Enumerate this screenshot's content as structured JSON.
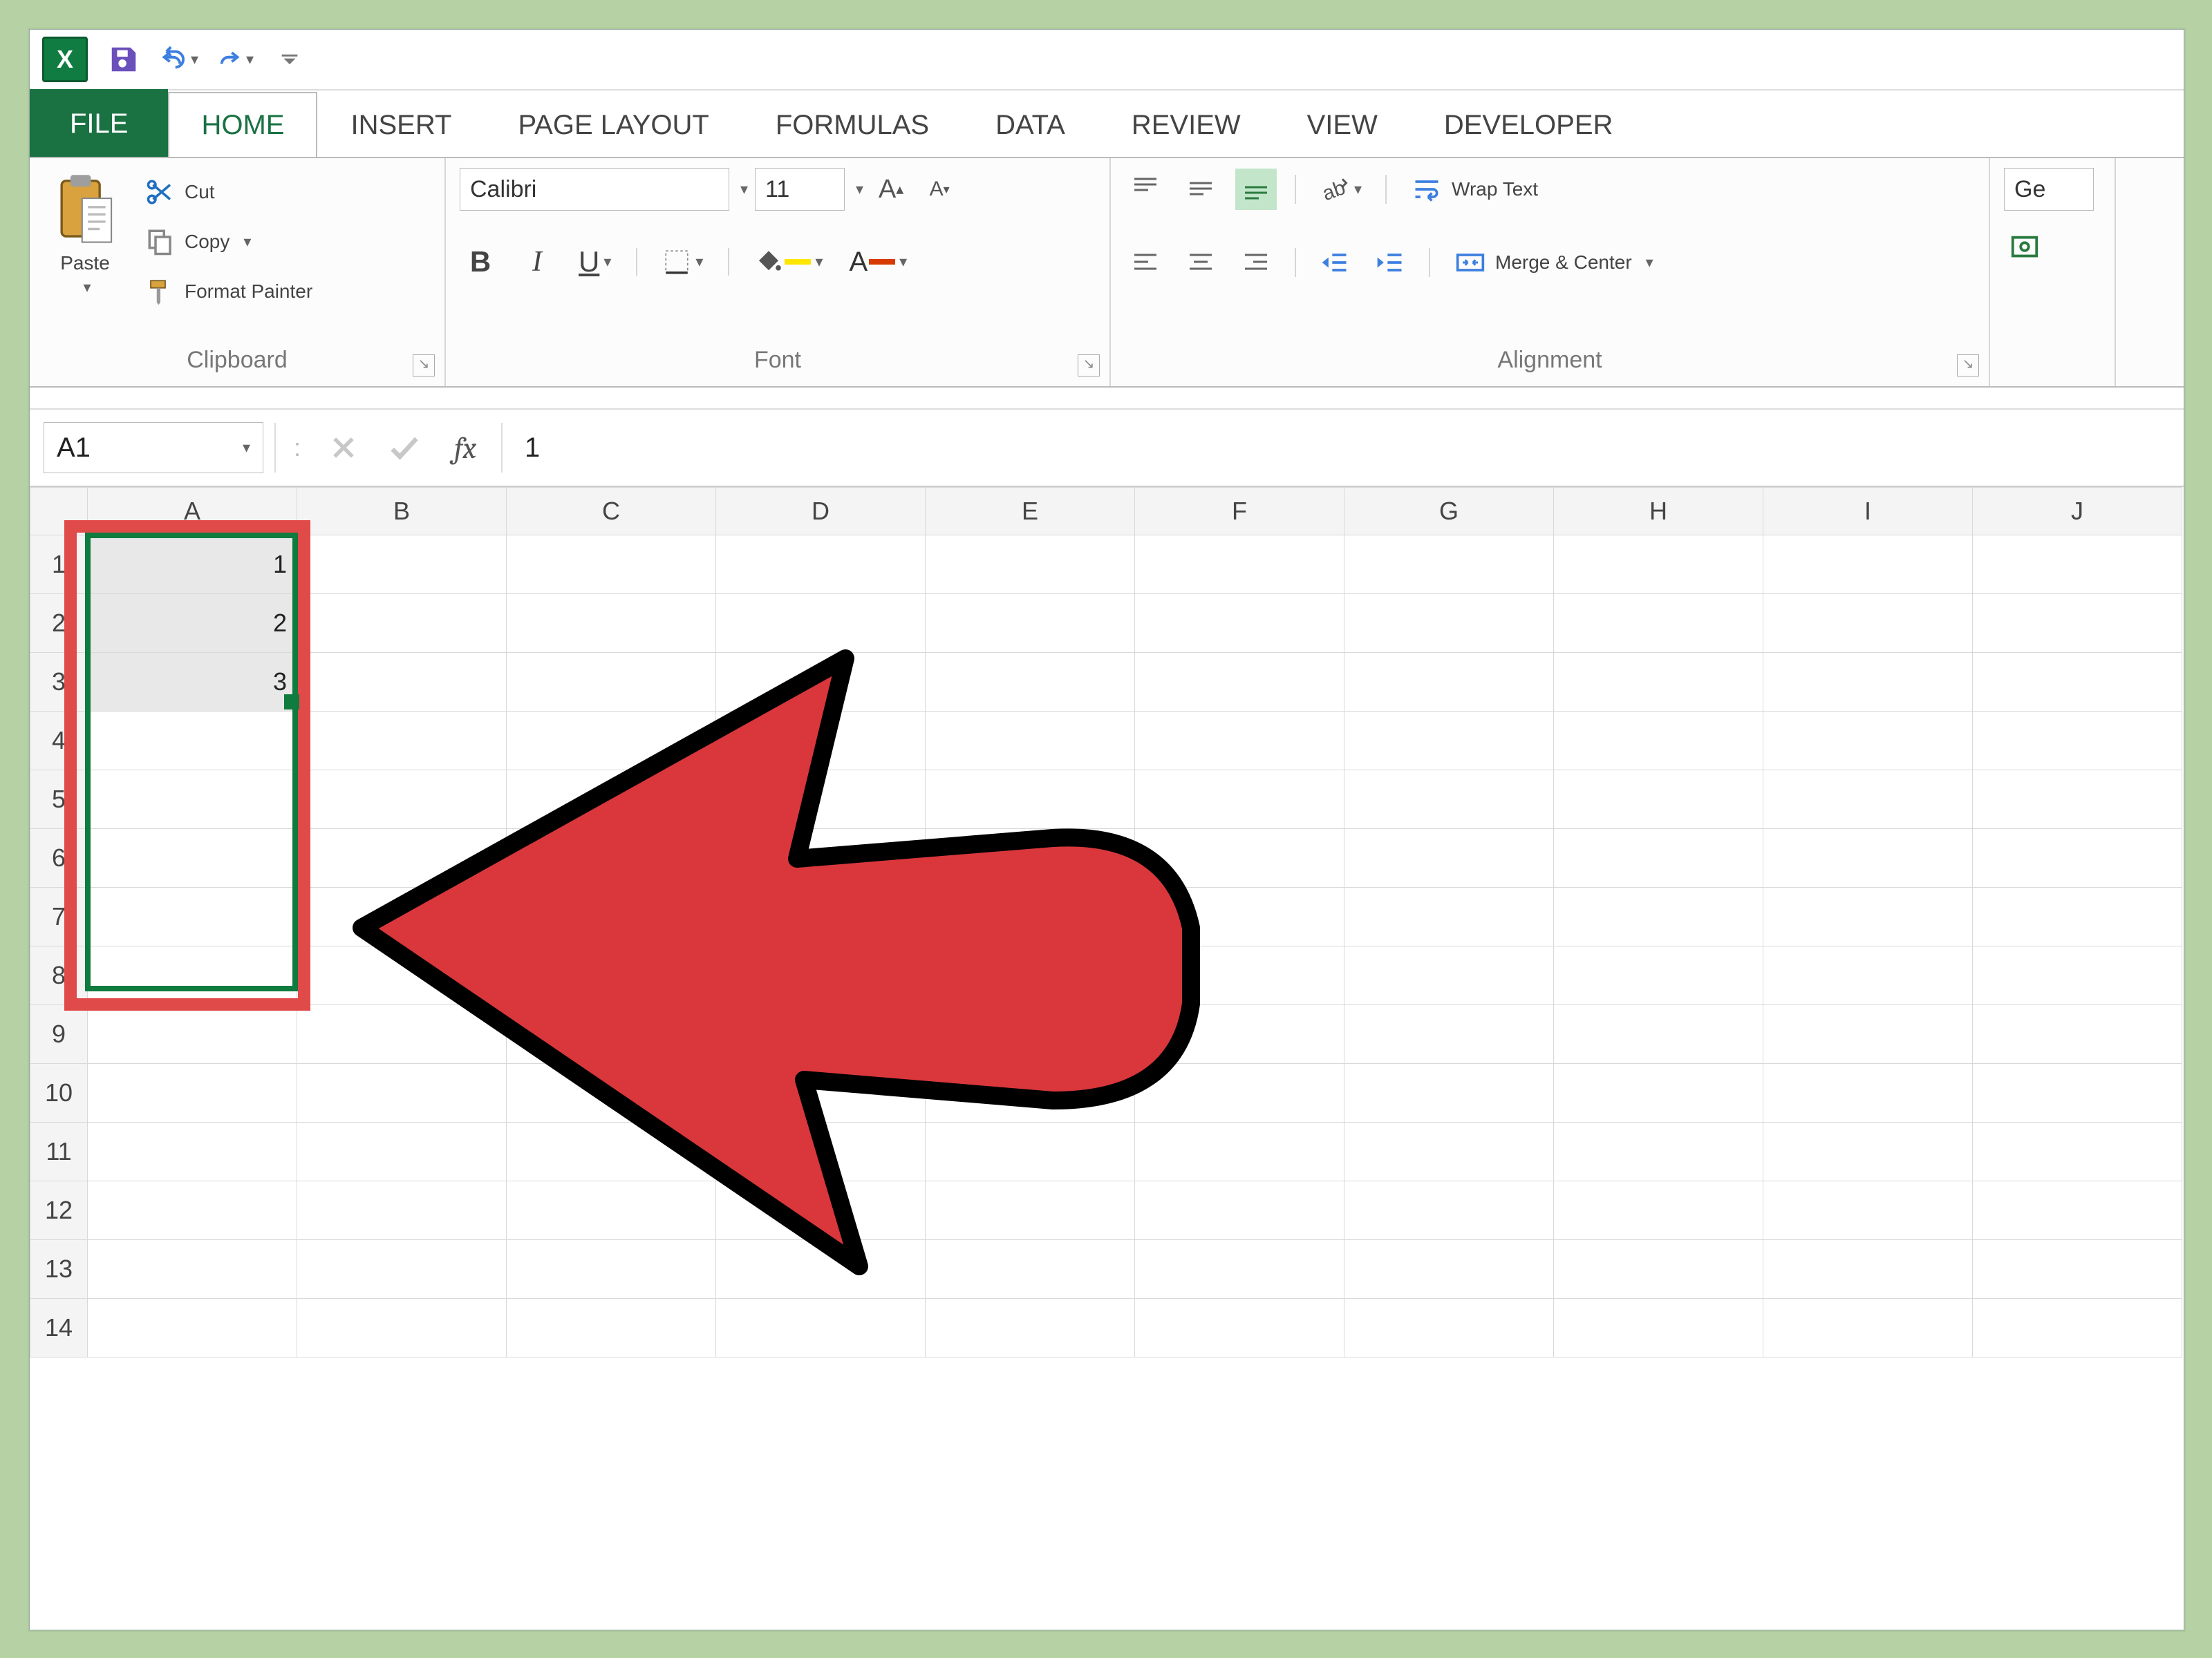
{
  "qat": {
    "save_icon": "save-icon",
    "undo_icon": "undo-icon",
    "redo_icon": "redo-icon",
    "customize_icon": "customize-qat-icon"
  },
  "tabs": {
    "file": "FILE",
    "home": "HOME",
    "insert": "INSERT",
    "page_layout": "PAGE LAYOUT",
    "formulas": "FORMULAS",
    "data": "DATA",
    "review": "REVIEW",
    "view": "VIEW",
    "developer": "DEVELOPER"
  },
  "clipboard": {
    "group_label": "Clipboard",
    "paste": "Paste",
    "cut": "Cut",
    "copy": "Copy",
    "format_painter": "Format Painter"
  },
  "font": {
    "group_label": "Font",
    "name": "Calibri",
    "size": "11",
    "bold": "B",
    "italic": "I",
    "underline": "U"
  },
  "alignment": {
    "group_label": "Alignment",
    "wrap_text": "Wrap Text",
    "merge_center": "Merge & Center"
  },
  "number": {
    "prefix": "Ge"
  },
  "formula_bar": {
    "cell_ref": "A1",
    "value": "1"
  },
  "grid": {
    "columns": [
      "A",
      "B",
      "C",
      "D",
      "E",
      "F",
      "G",
      "H",
      "I",
      "J"
    ],
    "rows": [
      "1",
      "2",
      "3",
      "4",
      "5",
      "6",
      "7",
      "8",
      "9",
      "10",
      "11",
      "12",
      "13",
      "14"
    ],
    "data": {
      "A1": "1",
      "A2": "2",
      "A3": "3"
    }
  }
}
